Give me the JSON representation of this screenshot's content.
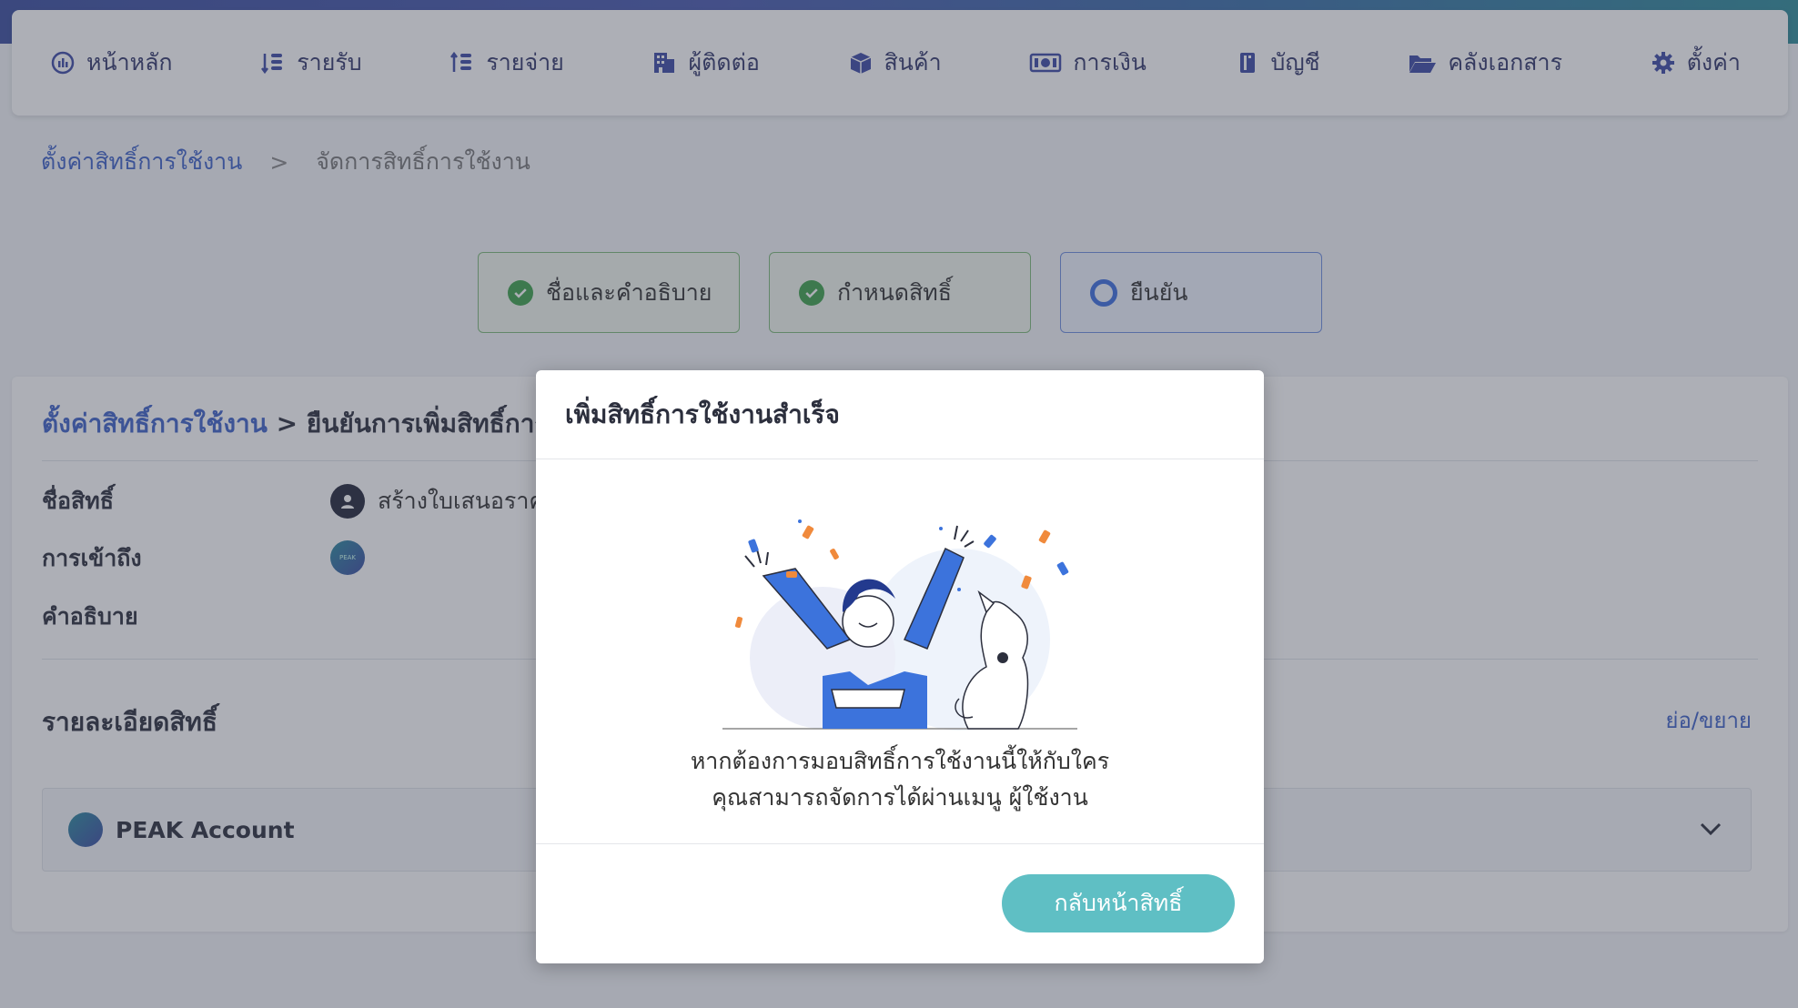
{
  "nav": {
    "items": [
      {
        "label": "หน้าหลัก",
        "icon": "dashboard-icon"
      },
      {
        "label": "รายรับ",
        "icon": "income-list-icon"
      },
      {
        "label": "รายจ่าย",
        "icon": "expense-list-icon"
      },
      {
        "label": "ผู้ติดต่อ",
        "icon": "contacts-building-icon"
      },
      {
        "label": "สินค้า",
        "icon": "product-box-icon"
      },
      {
        "label": "การเงิน",
        "icon": "money-icon"
      },
      {
        "label": "บัญชี",
        "icon": "accounting-book-icon"
      },
      {
        "label": "คลังเอกสาร",
        "icon": "folder-open-icon"
      },
      {
        "label": "ตั้งค่า",
        "icon": "gear-icon"
      }
    ]
  },
  "breadcrumb": {
    "parent": "ตั้งค่าสิทธิ์การใช้งาน",
    "separator": ">",
    "current": "จัดการสิทธิ์การใช้งาน"
  },
  "steps": [
    {
      "label": "ชื่อและคำอธิบาย",
      "state": "done"
    },
    {
      "label": "กำหนดสิทธิ์",
      "state": "done"
    },
    {
      "label": "ยืนยัน",
      "state": "active"
    }
  ],
  "card": {
    "title_link": "ตั้งค่าสิทธิ์การใช้งาน",
    "title_rest": " > ยืนยันการเพิ่มสิทธิ์การใช้",
    "name_label": "ชื่อสิทธิ์",
    "name_value": "สร้างใบเสนอราคา",
    "access_label": "การเข้าถึง",
    "access_badge": "PEAK",
    "description_label": "คำอธิบาย",
    "details_title": "รายละเอียดสิทธิ์",
    "toggle_label": "ย่อ/ขยาย",
    "account_name": "PEAK Account"
  },
  "modal": {
    "title": "เพิ่มสิทธิ์การใช้งานสำเร็จ",
    "message_line1": "หากต้องการมอบสิทธิ์การใช้งานนี้ให้กับใคร",
    "message_line2": "คุณสามารถจัดการได้ผ่านเมนู ผู้ใช้งาน",
    "button_label": "กลับหน้าสิทธิ์"
  },
  "colors": {
    "brand_blue": "#3f63c8",
    "success_green": "#3fa34d",
    "primary_button": "#5fbfc4"
  }
}
